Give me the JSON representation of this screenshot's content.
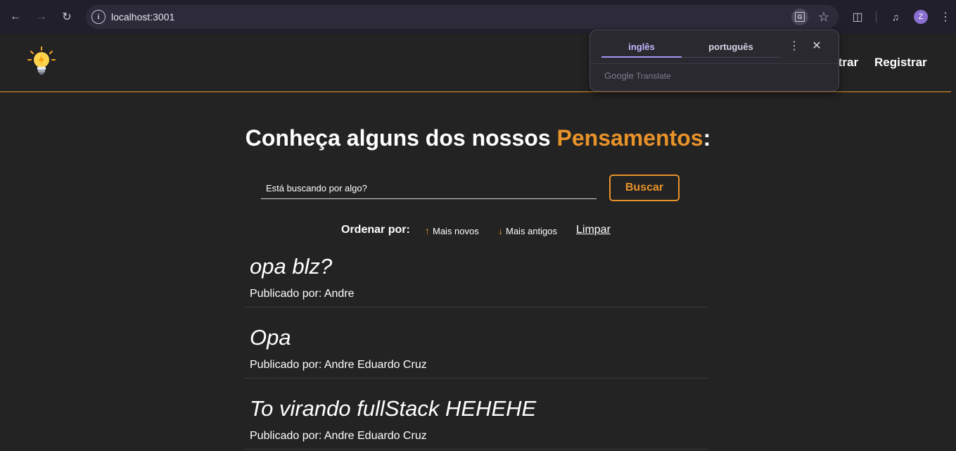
{
  "browser": {
    "url": "localhost:3001",
    "profile_initial": "Z"
  },
  "translate_popup": {
    "tabs": [
      "inglês",
      "português"
    ],
    "active_tab": "inglês",
    "brand_google": "Google",
    "brand_translate": "Translate"
  },
  "navbar": {
    "links": [
      "Entrar",
      "Registrar"
    ]
  },
  "main": {
    "heading_prefix": "Conheça alguns dos nossos ",
    "heading_highlight": "Pensamentos",
    "heading_suffix": ":",
    "search": {
      "placeholder": "Está buscando por algo?",
      "button_label": "Buscar"
    },
    "order": {
      "label": "Ordenar por:",
      "newest_label": "Mais novos",
      "oldest_label": "Mais antigos",
      "clear_label": "Limpar"
    },
    "thoughts": [
      {
        "title": "opa blz?",
        "author": "Publicado por: Andre"
      },
      {
        "title": "Opa",
        "author": "Publicado por: Andre Eduardo Cruz"
      },
      {
        "title": "To virando fullStack HEHEHE",
        "author": "Publicado por: Andre Eduardo Cruz"
      }
    ]
  },
  "colors": {
    "accent": "#e8922a",
    "background": "#232323",
    "chrome": "#201f2b"
  }
}
